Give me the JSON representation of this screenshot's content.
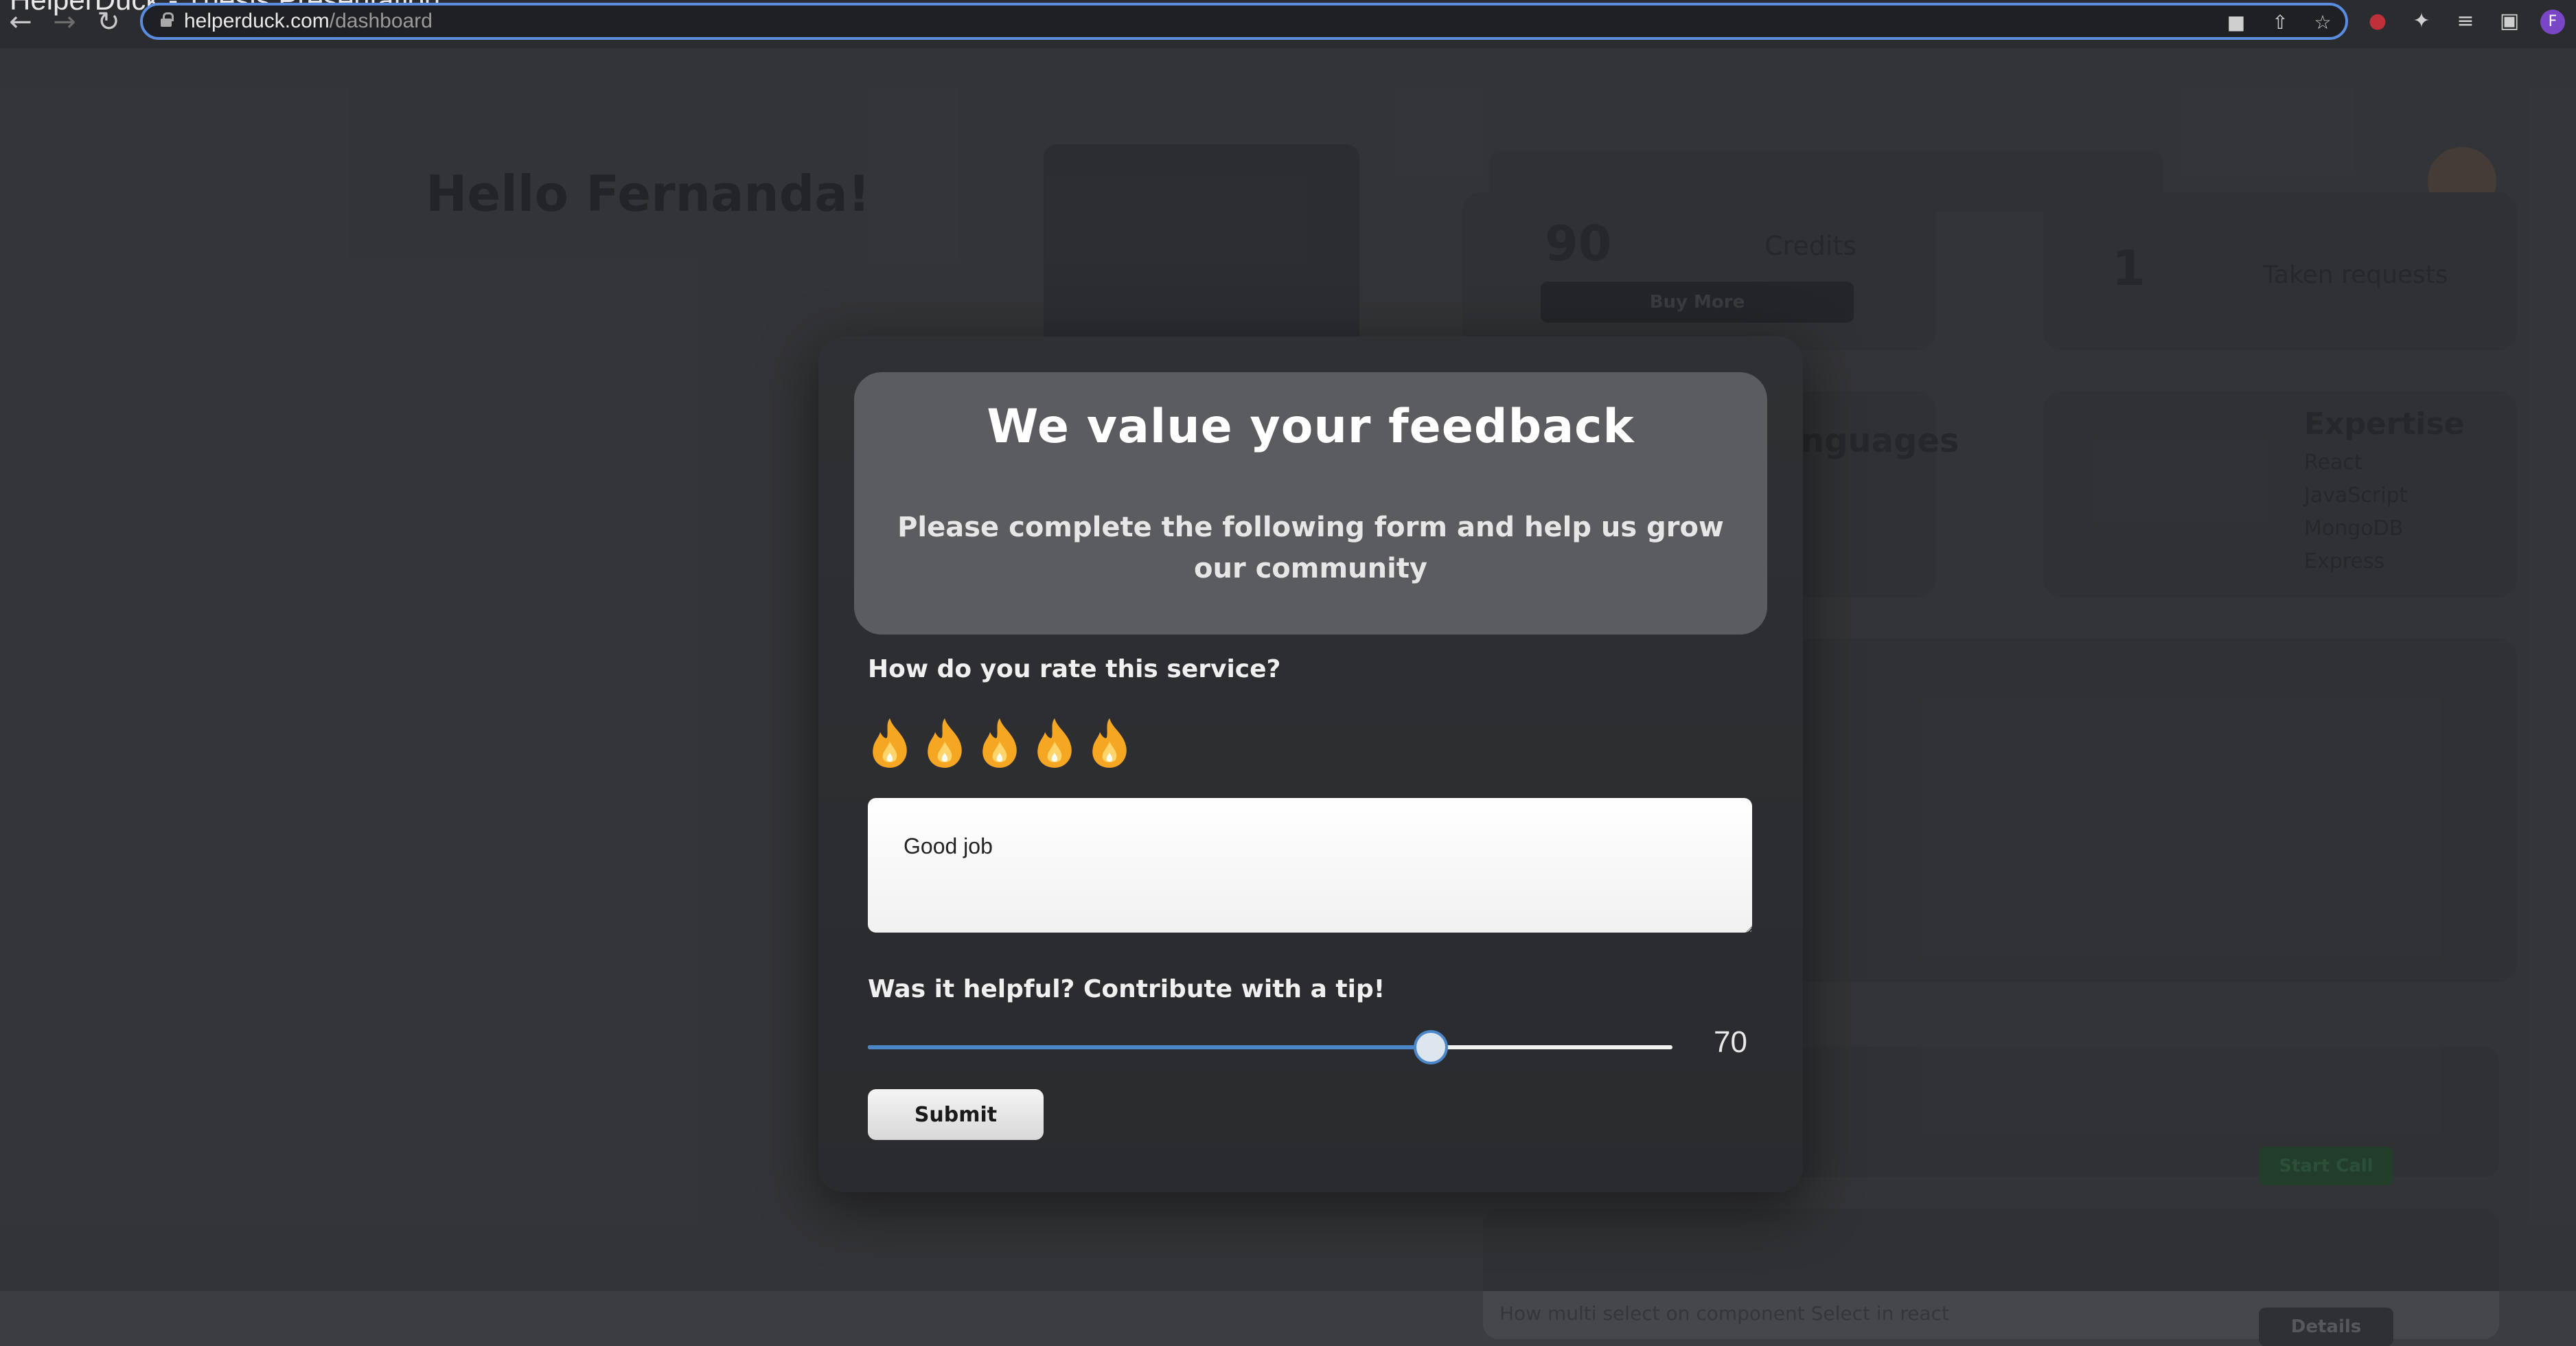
{
  "browser": {
    "tab_title": "HelperDuck - Thesis Presentation",
    "url_host": "helperduck.com",
    "url_path": "/dashboard",
    "profile_initial": "F"
  },
  "dashboard": {
    "greeting": "Hello Fernanda!",
    "credits_value": "90",
    "credits_label": "Credits",
    "buy_more_label": "Buy More",
    "taken_value": "1",
    "taken_label": "Taken requests",
    "languages_title": "Languages",
    "expertise_title": "Expertise",
    "expertise_items": [
      "React",
      "JavaScript",
      "MongoDB",
      "Express"
    ],
    "start_call_label": "Start Call",
    "details_label": "Details",
    "request_row_text": "How multi select on component Select in react"
  },
  "modal": {
    "title": "We value your feedback",
    "subtitle": "Please complete the following form and help us grow our community",
    "rating_question": "How do you rate this service?",
    "rating_max": 5,
    "rating_value": 5,
    "rating_icon": "flame-icon",
    "rating_color": "#f5a623",
    "comment_value": "Good job",
    "tip_question": "Was it helpful? Contribute with a tip!",
    "tip_value": 70,
    "tip_value_text": "70",
    "tip_max": 100,
    "tip_fill_color": "#4a86c8",
    "submit_label": "Submit"
  }
}
